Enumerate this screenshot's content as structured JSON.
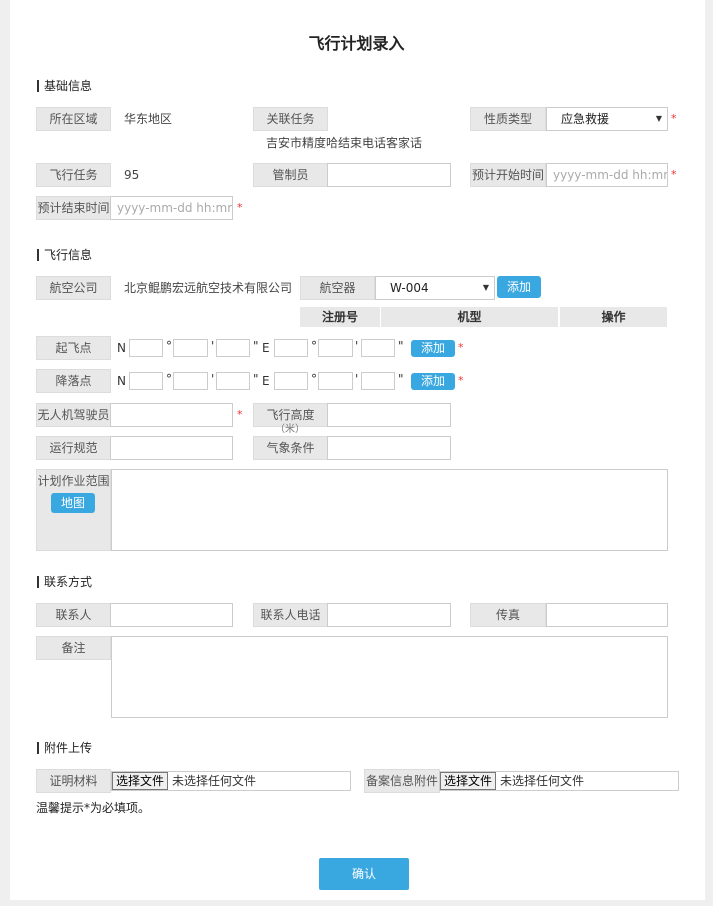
{
  "title": "飞行计划录入",
  "sections": {
    "basic": "基础信息",
    "flight": "飞行信息",
    "contact": "联系方式",
    "attachments": "附件上传"
  },
  "basic": {
    "region_label": "所在区域",
    "region_value": "华东地区",
    "task_label": "关联任务",
    "task_value": "吉安市精度哈结束电话客家话",
    "nature_label": "性质类型",
    "nature_value": "应急救援",
    "flight_task_label": "飞行任务",
    "flight_task_value": "95",
    "controller_label": "管制员",
    "controller_value": "",
    "start_label": "预计开始时间",
    "start_placeholder": "yyyy-mm-dd hh:mm",
    "end_label": "预计结束时间",
    "end_placeholder": "yyyy-mm-dd hh:mm"
  },
  "flight": {
    "airline_label": "航空公司",
    "airline_value": "北京鲲鹏宏远航空技术有限公司",
    "aircraft_label": "航空器",
    "aircraft_value": "W-004",
    "add_label": "添加",
    "table_headers": [
      "注册号",
      "机型",
      "操作"
    ],
    "takeoff_label": "起飞点",
    "landing_label": "降落点",
    "north": "N",
    "east": "E",
    "deg": "°",
    "min": "'",
    "sec": "\"",
    "pilot_label": "无人机驾驶员",
    "altitude_label": "飞行高度",
    "altitude_unit": "（米）",
    "rules_label": "运行规范",
    "weather_label": "气象条件",
    "area_label": "计划作业范围",
    "map_label": "地图"
  },
  "contact": {
    "person_label": "联系人",
    "phone_label": "联系人电话",
    "fax_label": "传真",
    "remark_label": "备注"
  },
  "attachments": {
    "cert_label": "证明材料",
    "record_label": "备案信息附件",
    "choose_file": "选择文件",
    "no_file": "未选择任何文件",
    "hint": "温馨提示*为必填项。"
  },
  "required_mark": "*",
  "confirm_label": "确认",
  "colors": {
    "accent": "#3aa8e0",
    "required": "#e33333",
    "label_bg": "#e8e8e8"
  }
}
